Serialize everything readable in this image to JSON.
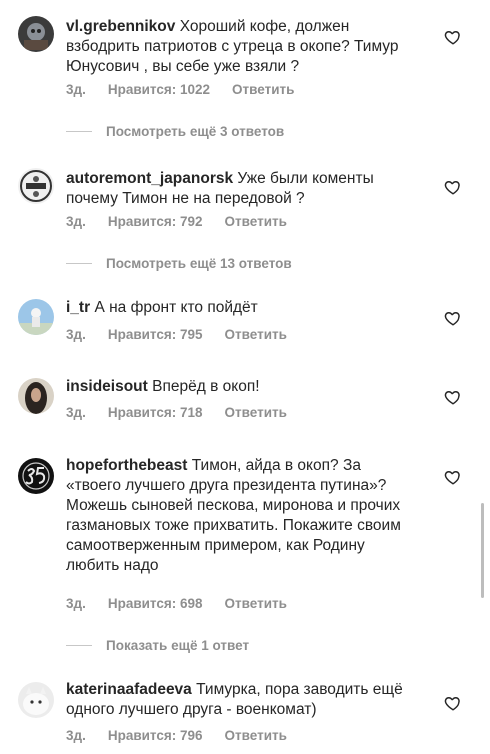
{
  "labels": {
    "reply": "Ответить"
  },
  "comments": [
    {
      "username": "vl.grebennikov",
      "text": "Хороший кофе, должен взбодрить патриотов с утреца в окопе? Тимур Юнусович , вы себе уже взяли ?",
      "age": "3д.",
      "likes": "Нравится: 1022",
      "view_more": "Посмотреть ещё 3 ответов"
    },
    {
      "username": "autoremont_japanorsk",
      "text": "Уже были коменты почему Тимон не на передовой ?",
      "age": "3д.",
      "likes": "Нравится: 792",
      "view_more": "Посмотреть ещё 13 ответов"
    },
    {
      "username": "i_tr",
      "text": "А на фронт кто пойдёт",
      "age": "3д.",
      "likes": "Нравится: 795"
    },
    {
      "username": "insideisout",
      "text": "Вперёд в окоп!",
      "age": "3д.",
      "likes": "Нравится: 718"
    },
    {
      "username": "hopeforthebeast",
      "text": "Тимон, айда в окоп? За «твоего лучшего друга президента путина»? Можешь сыновей пескова, миронова и прочих газмановых тоже прихватить. Покажите своим самоотверженным примером, как Родину любить надо",
      "age": "3д.",
      "likes": "Нравится: 698",
      "view_more": "Показать ещё 1 ответ"
    },
    {
      "username": "katerinaafadeeva",
      "text": "Тимурка, пора заводить ещё одного лучшего друга - военкомат)",
      "age": "3д.",
      "likes": "Нравится: 796"
    }
  ]
}
